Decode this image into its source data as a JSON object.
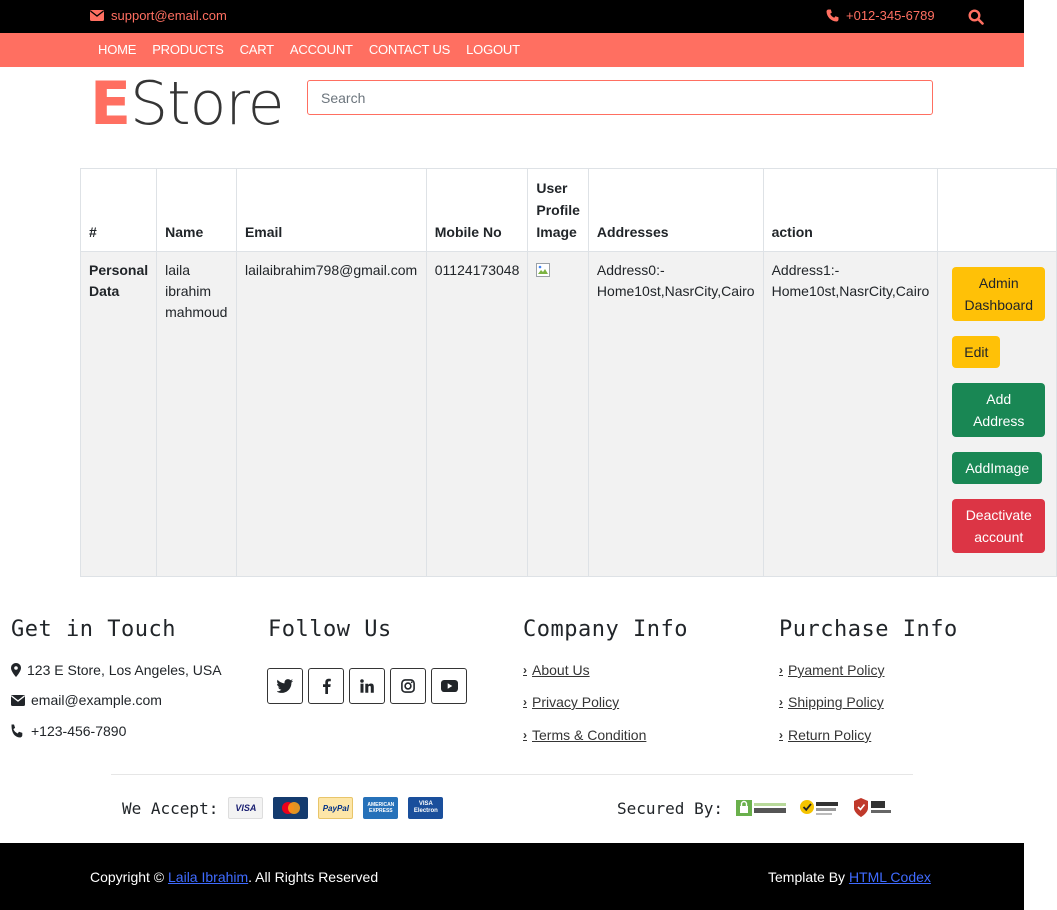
{
  "topbar": {
    "email": "support@email.com",
    "phone": "+012-345-6789"
  },
  "nav": [
    "HOME",
    "PRODUCTS",
    "CART",
    "ACCOUNT",
    "CONTACT US",
    "LOGOUT"
  ],
  "logo": {
    "first": "E",
    "rest": "Store"
  },
  "search": {
    "placeholder": "Search",
    "value": ""
  },
  "table": {
    "headers": [
      "#",
      "Name",
      "Email",
      "Mobile No",
      "User Profile Image",
      "Addresses",
      "action"
    ],
    "row": {
      "label": "Personal Data",
      "name": "laila ibrahim mahmoud",
      "email": "lailaibrahim798@gmail.com",
      "mobile": "01124173048",
      "address0": "Address0:- Home10st,NasrCity,Cairo",
      "address1": "Address1:- Home10st,NasrCity,Cairo"
    },
    "actions": {
      "admin": "Admin Dashboard",
      "edit": "Edit",
      "add_address": "Add Address",
      "add_image": "AddImage",
      "deactivate": "Deactivate account"
    }
  },
  "footer": {
    "touch": {
      "title": "Get in Touch",
      "address": "123 E Store, Los Angeles, USA",
      "email": "email@example.com",
      "phone": "+123-456-7890"
    },
    "follow": {
      "title": "Follow Us"
    },
    "company": {
      "title": "Company Info",
      "links": [
        "About Us",
        "Privacy Policy",
        "Terms & Condition"
      ]
    },
    "purchase": {
      "title": "Purchase Info",
      "links": [
        "Pyament Policy",
        "Shipping Policy",
        "Return Policy"
      ]
    },
    "accept_label": "We Accept:",
    "secured_label": "Secured By:"
  },
  "bottom": {
    "copy_prefix": "Copyright ©",
    "copy_name": "Laila Ibrahim",
    "copy_suffix": ". All Rights Reserved",
    "template_prefix": "Template By",
    "template_name": "HTML Codex"
  },
  "colors": {
    "accent": "#ff6f61",
    "warning": "#ffc107",
    "success": "#198754",
    "danger": "#dc3545"
  }
}
